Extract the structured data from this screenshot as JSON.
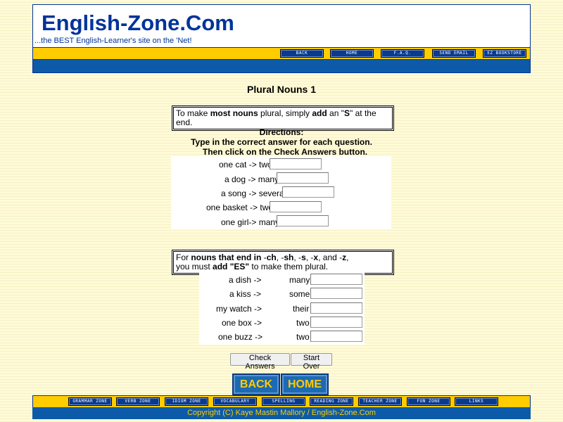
{
  "header": {
    "logo": "English-Zone.Com",
    "tagline": "...the BEST English-Learner's site on the 'Net!",
    "nav": [
      "BACK",
      "HOME",
      "F.A.Q.",
      "SEND EMAIL",
      "EZ BOOKSTORE"
    ]
  },
  "page_title": "Plural Nouns 1",
  "rule1": {
    "t1": "To make ",
    "b1": "most nouns",
    "t2": " plural, simply ",
    "b2": "add",
    "t3": " an \"",
    "b3": "S",
    "t4": "\" at the end."
  },
  "directions": {
    "heading": "Directions:",
    "line1": "Type in the correct answer for each question.",
    "line2": "Then click on the Check Answers button."
  },
  "section1": [
    {
      "prompt": "one cat -> two",
      "value": ""
    },
    {
      "prompt": "a dog -> many",
      "value": ""
    },
    {
      "prompt": "a song -> several",
      "value": ""
    },
    {
      "prompt": "one basket -> two",
      "value": ""
    },
    {
      "prompt": "one girl-> many",
      "value": ""
    }
  ],
  "rule2": {
    "t1": "For ",
    "b1": "nouns that end in",
    "t2": " -",
    "b2": "ch",
    "t3": ", -",
    "b3": "sh",
    "t4": ", -",
    "b4": "s",
    "t5": ", -",
    "b5": "x",
    "t6": ", and -",
    "b6": "z",
    "t7": ",",
    "t8": "you must ",
    "b7": "add \"ES\"",
    "t9": " to make them plural."
  },
  "section2": [
    {
      "left": "a dish ->",
      "right": "many",
      "value": ""
    },
    {
      "left": "a kiss ->",
      "right": "some",
      "value": ""
    },
    {
      "left": "my watch ->",
      "right": "their",
      "value": ""
    },
    {
      "left": "one box ->",
      "right": "two",
      "value": ""
    },
    {
      "left": "one buzz ->",
      "right": "two",
      "value": ""
    }
  ],
  "buttons": {
    "check": "Check Answers",
    "reset": "Start Over",
    "back": "BACK",
    "home": "HOME"
  },
  "footer": {
    "nav": [
      "GRAMMAR ZONE",
      "VERB ZONE",
      "IDIOM ZONE",
      "VOCABULARY",
      "SPELLING",
      "READING ZONE",
      "TEACHER ZONE",
      "FUN ZONE",
      "LINKS"
    ],
    "copyright": "Copyright (C) Kaye Mastin Mallory / English-Zone.Com"
  },
  "colors": {
    "navy": "#003399",
    "gold": "#ffcc00",
    "blue": "#0d5ba8",
    "background": "#fffbd8"
  }
}
